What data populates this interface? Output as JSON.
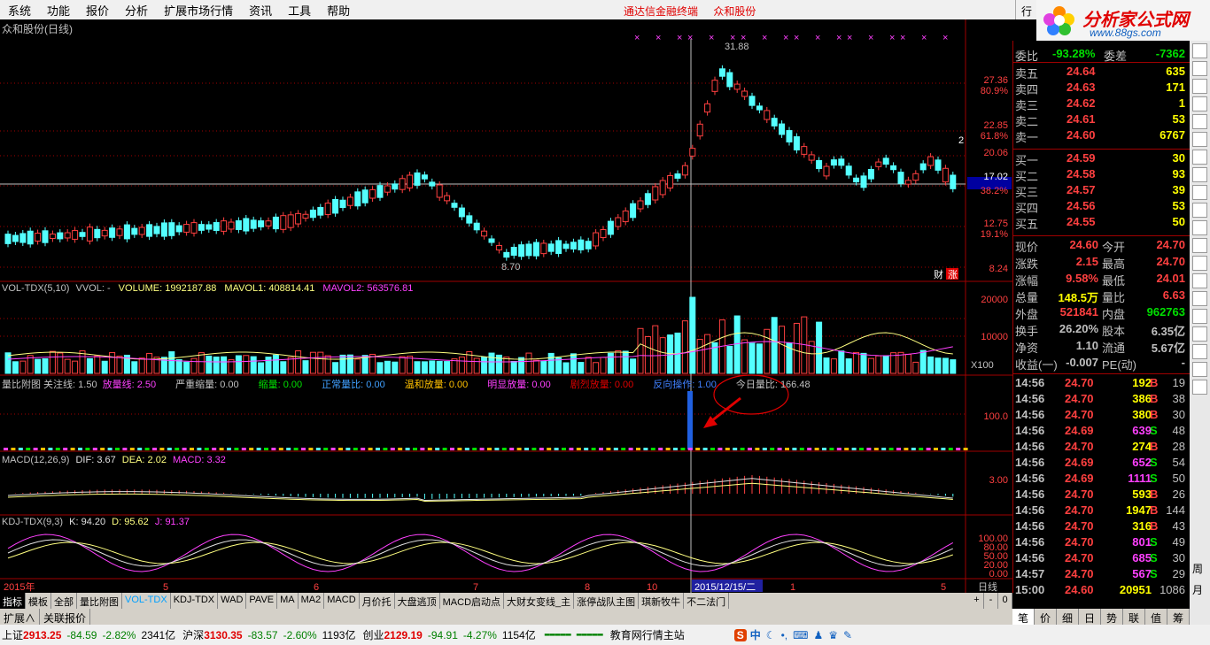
{
  "menu": [
    "系统",
    "功能",
    "报价",
    "分析",
    "扩展市场行情",
    "资讯",
    "工具",
    "帮助"
  ],
  "center_title": [
    "通达信金融终端",
    "众和股份"
  ],
  "window_btn": "行",
  "logo": {
    "main": "分析家公式网",
    "url": "www.88gs.com"
  },
  "stock_title": "众和股份(日线)",
  "main_chart": {
    "y_labels": [
      "27.36",
      "80.9%",
      "22.85",
      "61.8%",
      "20.06",
      "17.02",
      "38.2%",
      "12.75",
      "19.1%",
      "8.24"
    ],
    "annotations": {
      "high": "31.88",
      "low": "8.70"
    },
    "badge_cai": "财",
    "badge_zhang": "涨",
    "right_mark": "2"
  },
  "vol": {
    "title": "VOL-TDX(5,10)",
    "vvol": "VVOL: -",
    "volume": "VOLUME: 1992187.88",
    "mavol1": "MAVOL1: 408814.41",
    "mavol2": "MAVOL2: 563576.81",
    "y_labels": [
      "20000",
      "10000",
      "X100"
    ]
  },
  "lbft": {
    "items": [
      {
        "t": "量比附图 关注线: 1.50",
        "c": "#c0c0c0"
      },
      {
        "t": "放量线: 2.50",
        "c": "#ff40ff"
      },
      {
        "t": "严重缩量: 0.00",
        "c": "#c0c0c0"
      },
      {
        "t": "缩量: 0.00",
        "c": "#00e000"
      },
      {
        "t": "正常量比: 0.00",
        "c": "#40a0ff"
      },
      {
        "t": "温和放量: 0.00",
        "c": "#ffc000"
      },
      {
        "t": "明显放量: 0.00",
        "c": "#ff40ff"
      },
      {
        "t": "剧烈放量: 0.00",
        "c": "#e00000"
      },
      {
        "t": "反向操作: 1.00",
        "c": "#4080ff"
      },
      {
        "t": "今日量比: 166.48",
        "c": "#c0c0c0"
      }
    ],
    "y_label": "100.0"
  },
  "macd": {
    "title": "MACD(12,26,9)",
    "dif": "DIF: 3.67",
    "dea": "DEA: 2.02",
    "macd": "MACD: 3.32",
    "y_label": "3.00"
  },
  "kdj": {
    "title": "KDJ-TDX(9,3)",
    "k": "K: 94.20",
    "d": "D: 95.62",
    "j": "J: 91.37",
    "y_labels": [
      "100.00",
      "80.00",
      "50.00",
      "20.00",
      "0.00"
    ]
  },
  "time_axis": {
    "labels": [
      "2015年",
      "5",
      "6",
      "7",
      "8",
      "10",
      "12",
      "2015/12/15/二",
      "1",
      "5"
    ],
    "period": "日线"
  },
  "right_panel": {
    "weibi": {
      "label": "委比",
      "value": "-93.28%",
      "label2": "委差",
      "value2": "-7362"
    },
    "sells": [
      {
        "label": "卖五",
        "price": "24.64",
        "vol": "635"
      },
      {
        "label": "卖四",
        "price": "24.63",
        "vol": "171"
      },
      {
        "label": "卖三",
        "price": "24.62",
        "vol": "1"
      },
      {
        "label": "卖二",
        "price": "24.61",
        "vol": "53"
      },
      {
        "label": "卖一",
        "price": "24.60",
        "vol": "6767"
      }
    ],
    "buys": [
      {
        "label": "买一",
        "price": "24.59",
        "vol": "30"
      },
      {
        "label": "买二",
        "price": "24.58",
        "vol": "93"
      },
      {
        "label": "买三",
        "price": "24.57",
        "vol": "39"
      },
      {
        "label": "买四",
        "price": "24.56",
        "vol": "53"
      },
      {
        "label": "买五",
        "price": "24.55",
        "vol": "50"
      }
    ],
    "stats": [
      {
        "l1": "现价",
        "v1": "24.60",
        "l2": "今开",
        "v2": "24.70"
      },
      {
        "l1": "涨跌",
        "v1": "2.15",
        "l2": "最高",
        "v2": "24.70"
      },
      {
        "l1": "涨幅",
        "v1": "9.58%",
        "l2": "最低",
        "v2": "24.01"
      },
      {
        "l1": "总量",
        "v1": "148.5万",
        "l2": "量比",
        "v2": "6.63"
      },
      {
        "l1": "外盘",
        "v1": "521841",
        "l2": "内盘",
        "v2": "962763"
      },
      {
        "l1": "换手",
        "v1": "26.20%",
        "l2": "股本",
        "v2": "6.35亿"
      },
      {
        "l1": "净资",
        "v1": "1.10",
        "l2": "流通",
        "v2": "5.67亿"
      },
      {
        "l1": "收益(一)",
        "v1": "-0.007",
        "l2": "PE(动)",
        "v2": "-"
      }
    ],
    "ticks": [
      {
        "t": "14:56",
        "p": "24.70",
        "v": "192",
        "bs": "B",
        "n": "19"
      },
      {
        "t": "14:56",
        "p": "24.70",
        "v": "386",
        "bs": "B",
        "n": "38"
      },
      {
        "t": "14:56",
        "p": "24.70",
        "v": "380",
        "bs": "B",
        "n": "30"
      },
      {
        "t": "14:56",
        "p": "24.69",
        "v": "639",
        "bs": "S",
        "n": "48"
      },
      {
        "t": "14:56",
        "p": "24.70",
        "v": "274",
        "bs": "B",
        "n": "28"
      },
      {
        "t": "14:56",
        "p": "24.69",
        "v": "652",
        "bs": "S",
        "n": "54"
      },
      {
        "t": "14:56",
        "p": "24.69",
        "v": "1111",
        "bs": "S",
        "n": "50"
      },
      {
        "t": "14:56",
        "p": "24.70",
        "v": "593",
        "bs": "B",
        "n": "26"
      },
      {
        "t": "14:56",
        "p": "24.70",
        "v": "1947",
        "bs": "B",
        "n": "144"
      },
      {
        "t": "14:56",
        "p": "24.70",
        "v": "316",
        "bs": "B",
        "n": "43"
      },
      {
        "t": "14:56",
        "p": "24.70",
        "v": "801",
        "bs": "S",
        "n": "49"
      },
      {
        "t": "14:56",
        "p": "24.70",
        "v": "685",
        "bs": "S",
        "n": "30"
      },
      {
        "t": "14:57",
        "p": "24.70",
        "v": "567",
        "bs": "S",
        "n": "29"
      },
      {
        "t": "15:00",
        "p": "24.60",
        "v": "20951",
        "bs": "",
        "n": "1086"
      }
    ]
  },
  "bottom_tabs": [
    "指标",
    "模板",
    "全部",
    "量比附图",
    "VOL-TDX",
    "KDJ-TDX",
    "WAD",
    "PAVE",
    "MA",
    "MA2",
    "MACD",
    "月价托",
    "大盘逃顶",
    "MACD启动点",
    "大财女变线_主",
    "涨停战队主图",
    "琪新牧牛",
    "不二法门"
  ],
  "bottom_ctrl": [
    "+",
    "-",
    "0"
  ],
  "bottom_tabs2": [
    "扩展∧",
    "关联报价"
  ],
  "rp_tabs": [
    "笔",
    "价",
    "细",
    "日",
    "势",
    "联",
    "值",
    "筹"
  ],
  "status": {
    "sh": {
      "name": "上证",
      "val": "2913.25",
      "chg": "-84.59",
      "pct": "-2.82%",
      "amt": "2341亿"
    },
    "sz": {
      "name": "沪深",
      "val": "3130.35",
      "chg": "-83.57",
      "pct": "-2.60%",
      "amt": "1193亿"
    },
    "cy": {
      "name": "创业",
      "val": "2129.19",
      "chg": "-94.91",
      "pct": "-4.27%",
      "amt": "1154亿"
    },
    "site": "教育网行情主站"
  },
  "side_icons": [
    "周",
    "月"
  ],
  "colors": {
    "up": "#ff4040",
    "down": "#54ffff",
    "bg": "#000000",
    "grid": "#a00000"
  }
}
